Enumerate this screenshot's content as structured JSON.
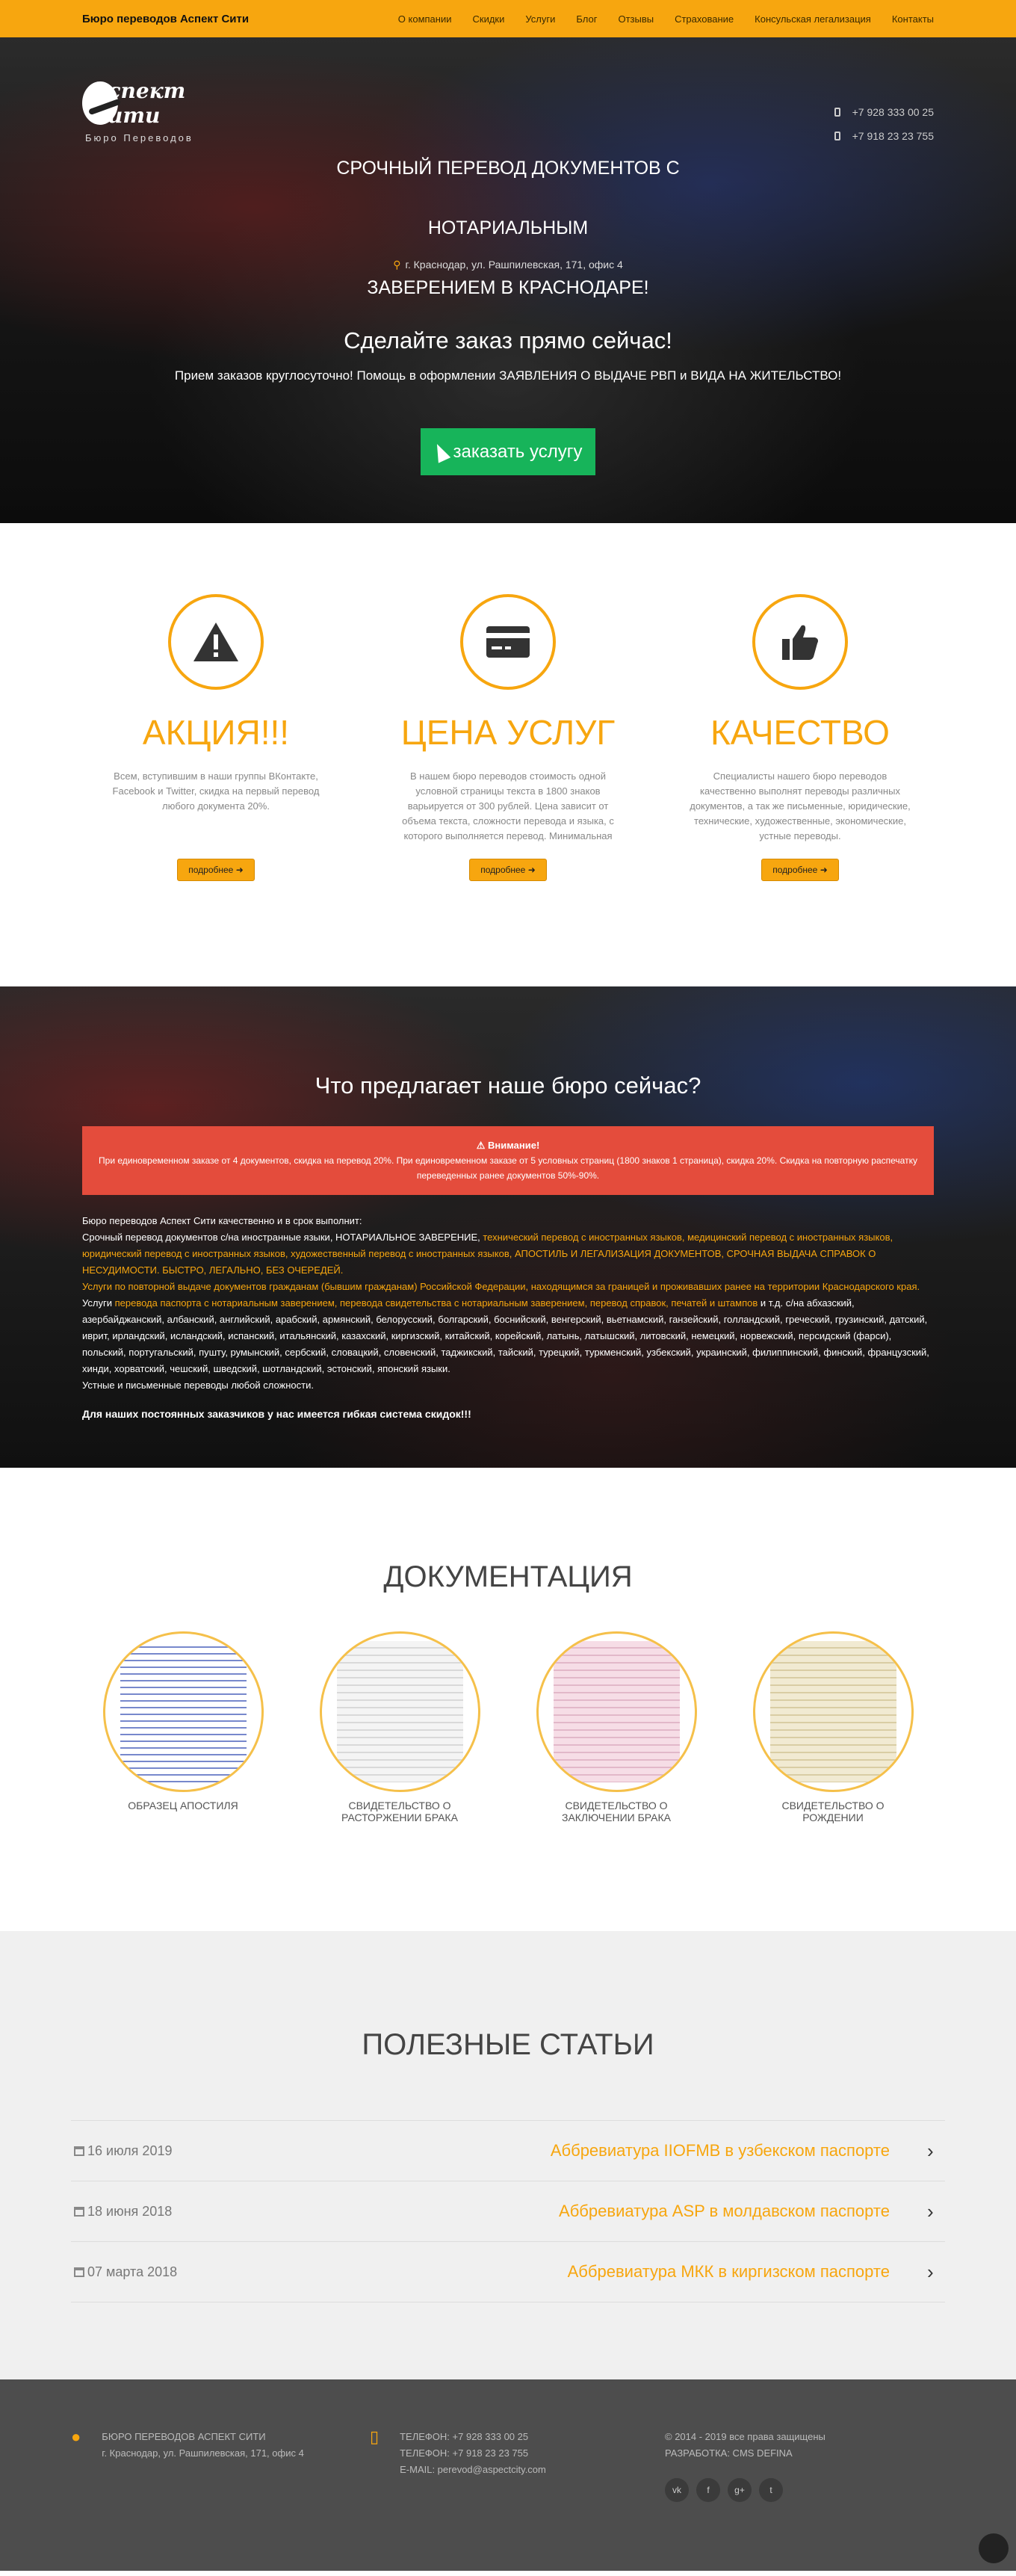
{
  "nav": {
    "brand": "Бюро переводов Аспект Сити",
    "items": [
      "О компании",
      "Скидки",
      "Услуги",
      "Блог",
      "Отзывы",
      "Страхование",
      "Консульская легализация",
      "Контакты"
    ]
  },
  "hero": {
    "logo_text": "Аспект Сити",
    "logo_sub": "Бюро Переводов",
    "title_line1": "СРОЧНЫЙ ПЕРЕВОД ДОКУМЕНТОВ С НОТАРИАЛЬНЫМ",
    "title_line2": "ЗАВЕРЕНИЕМ В КРАСНОДАРЕ!",
    "address": "г. Краснодар, ул. Рашпилевская, 171, офис 4",
    "phones": [
      "+7 928 333 00 25",
      "+7 918 23 23 755"
    ],
    "cta_title": "Сделайте заказ прямо сейчас!",
    "cta_sub": "Прием заказов круглосуточно! Помощь в оформлении ЗАЯВЛЕНИЯ О ВЫДАЧЕ РВП и ВИДА НА ЖИТЕЛЬСТВО!",
    "order_button": "заказать услугу"
  },
  "features": [
    {
      "icon": "warning-icon",
      "title": "АКЦИЯ!!!",
      "text": "Всем, вступившим в наши группы ВКонтакте, Facebook и Twitter, скидка на первый перевод любого документа 20%.",
      "button": "подробнее ➜"
    },
    {
      "icon": "credit-card-icon",
      "title": "ЦЕНА УСЛУГ",
      "text": "В нашем бюро переводов стоимость одной условной страницы текста в 1800 знаков варьируется от 300 рублей. Цена зависит от объема текста, сложности перевода и языка, с которого выполняется перевод. Минимальная стоимость заказа или",
      "button": "подробнее ➜"
    },
    {
      "icon": "thumbs-up-icon",
      "title": "КАЧЕСТВО",
      "text": "Специалисты нашего бюро переводов качественно выполнят переводы различных документов, а так же письменные, юридические, технические, художественные, экономические, устные переводы.",
      "button": "подробнее ➜"
    }
  ],
  "offer": {
    "title": "Что предлагает наше бюро сейчас?",
    "alert_title": "⚠ Внимание!",
    "alert_text": "При единовременном заказе от 4 документов, скидка на перевод 20%.   При единовременном заказе от 5 условных страниц (1800 знаков 1 страница), скидка 20%. Скидка на повторную распечатку переведенных ранее документов 50%-90%.",
    "intro": "Бюро переводов Аспект Сити качественно и в срок выполнит:",
    "line1": "Срочный перевод документов с/на иностранные языки, НОТАРИАЛЬНОЕ ЗАВЕРЕНИЕ,",
    "line1_o": " технический перевод с иностранных языков, медицинский перевод с иностранных языков, юридический перевод с иностранных языков, художественный перевод с иностранных языков, АПОСТИЛЬ И ЛЕГАЛИЗАЦИЯ ДОКУМЕНТОВ, СРОЧНАЯ ВЫДАЧА СПРАВОК О НЕСУДИМОСТИ. БЫСТРО, ЛЕГАЛЬНО, БЕЗ ОЧЕРЕДЕЙ.",
    "line2_o": "Услуги по повторной выдаче документов гражданам (бывшим гражданам) Российской Федерации, находящимся за границей и проживавших ранее на территории Краснодарского края.",
    "line3a": "Услуги ",
    "line3_o": "перевода паспорта с нотариальным заверением, перевода свидетельства с нотариальным заверением, перевод справок, печатей и штампов",
    "line3b": " и т.д. с/на абхазский, азербайджанский, албанский, английский, арабский, армянский, белорусский, болгарский, боснийский, венгерский, вьетнамский, ганзейский, голландский, греческий, грузинский, датский, иврит, ирландский, исландский, испанский, итальянский, казахский, киргизский, китайский, корейский, латынь, латышский, литовский, немецкий, норвежский, персидский (фарси), польский, португальский, пушту, румынский, сербский, словацкий, словенский, таджикский, тайский, турецкий, туркменский, узбекский, украинский, филиппинский, финский, французский, хинди, хорватский, чешский, шведский, шотландский, эстонский, японский языки.",
    "line4": "Устные и письменные переводы любой сложности.",
    "bold": "Для наших постоянных заказчиков у нас имеется гибкая система скидок!!!"
  },
  "docs": {
    "title": "ДОКУМЕНТАЦИЯ",
    "items": [
      "ОБРАЗЕЦ АПОСТИЛЯ",
      "СВИДЕТЕЛЬСТВО О РАСТОРЖЕНИИ БРАКА",
      "СВИДЕТЕЛЬСТВО О ЗАКЛЮЧЕНИИ БРАКА",
      "СВИДЕТЕЛЬСТВО О РОЖДЕНИИ"
    ]
  },
  "articles": {
    "title": "ПОЛЕЗНЫЕ СТАТЬИ",
    "items": [
      {
        "date": "16 июля 2019",
        "title": "Аббревиатура IIOFMB в узбекском паспорте"
      },
      {
        "date": "18 июня 2018",
        "title": "Аббревиатура ASP в молдавском паспорте"
      },
      {
        "date": "07 марта 2018",
        "title": "Аббревиатура МКК в киргизском паспорте"
      }
    ]
  },
  "footer": {
    "org": "БЮРО ПЕРЕВОДОВ АСПЕКТ СИТИ",
    "address": "г. Краснодар, ул. Рашпилевская, 171, офис 4",
    "phone1": "ТЕЛЕФОН: +7 928 333 00 25",
    "phone2": "ТЕЛЕФОН: +7 918 23 23 755",
    "email": "E-MAIL: perevod@aspectcity.com",
    "copyright": "© 2014 - 2019 все права защищены",
    "dev": "РАЗРАБОТКА: CMS DEFINA",
    "social": [
      "vk",
      "f",
      "g+",
      "t"
    ]
  }
}
